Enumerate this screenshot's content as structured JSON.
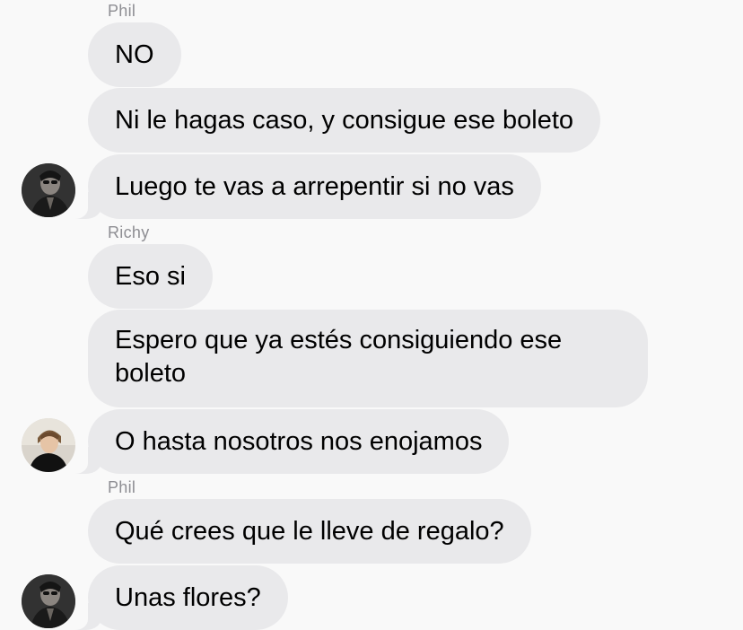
{
  "thread": {
    "messages": [
      {
        "sender": "Phil",
        "text": "NO"
      },
      {
        "text": "Ni le hagas caso, y consigue ese boleto"
      },
      {
        "text": "Luego te vas a arrepentir si no vas",
        "avatar": "phil-avatar"
      },
      {
        "sender": "Richy",
        "text": "Eso si"
      },
      {
        "text": "Espero que ya estés consiguiendo ese boleto"
      },
      {
        "text": "O hasta nosotros nos enojamos",
        "avatar": "richy-avatar"
      },
      {
        "sender": "Phil",
        "text": "Qué crees que le lleve de regalo?"
      },
      {
        "text": "Unas flores?",
        "avatar": "phil-avatar"
      }
    ]
  },
  "colors": {
    "background": "#f9f9f9",
    "incoming_bubble": "#e9e9eb",
    "sender_label": "#8e8e93",
    "text": "#000000"
  }
}
